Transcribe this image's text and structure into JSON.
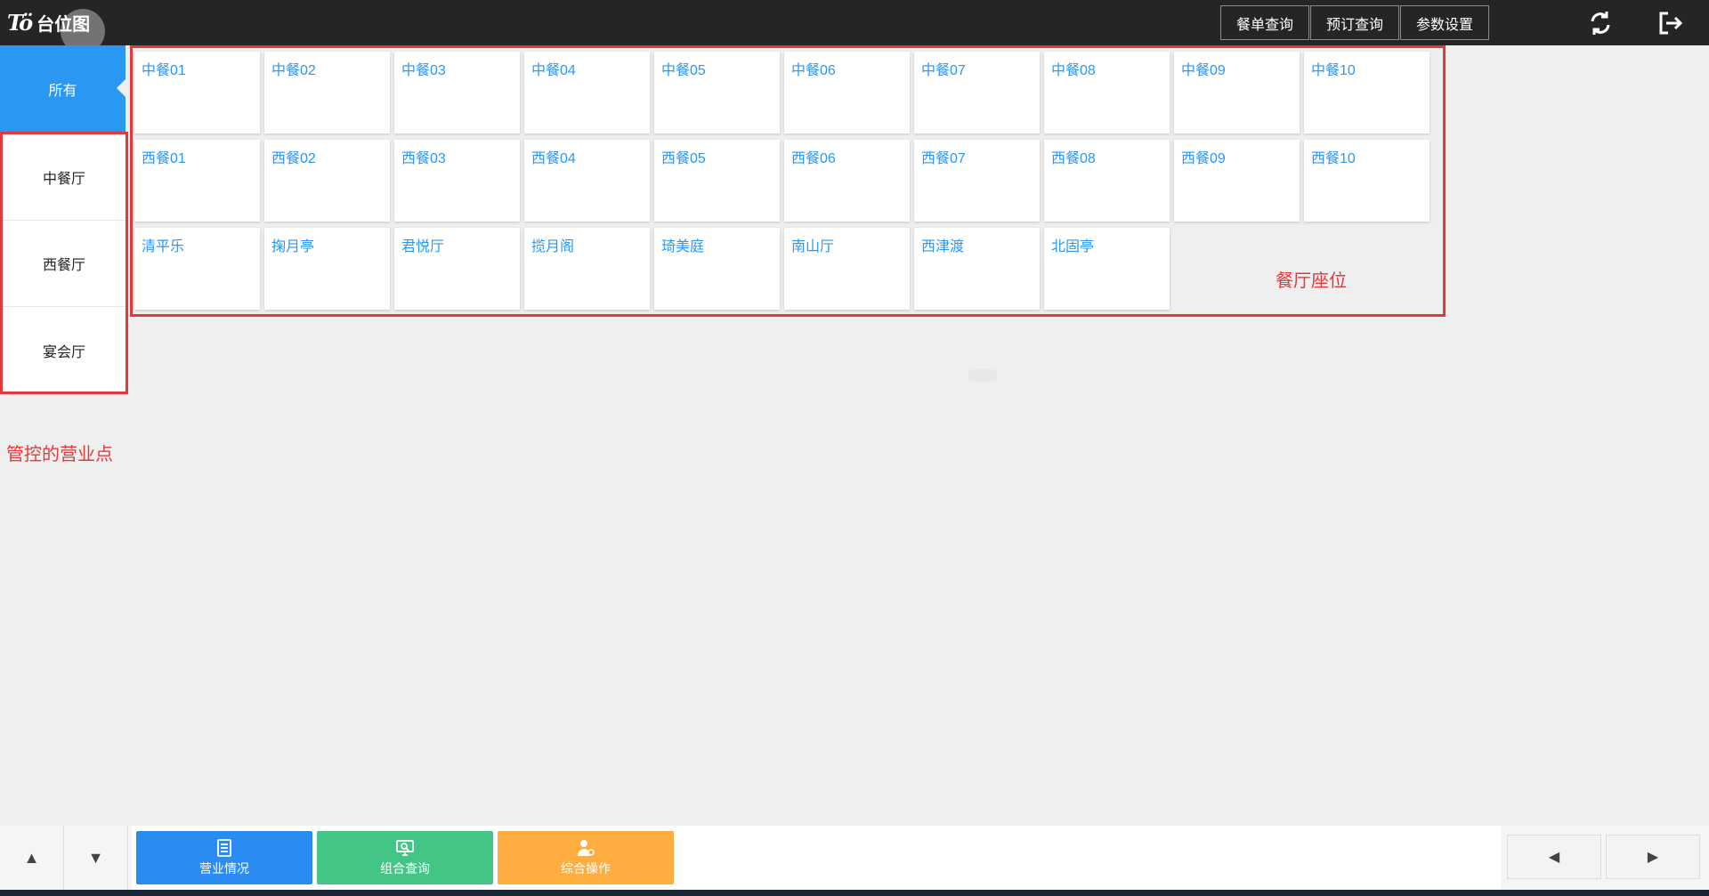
{
  "app": {
    "logo_mark": "Tö",
    "title": "台位图"
  },
  "header": {
    "menu": [
      "餐单查询",
      "预订查询",
      "参数设置"
    ],
    "refresh_icon": "refresh-icon",
    "logout_icon": "logout-icon"
  },
  "sidebar": {
    "all_label": "所有",
    "items": [
      "中餐厅",
      "西餐厅",
      "宴会厅"
    ],
    "annotation": "管控的营业点"
  },
  "tables": {
    "annotation": "餐厅座位",
    "rows": [
      [
        "中餐01",
        "中餐02",
        "中餐03",
        "中餐04",
        "中餐05",
        "中餐06",
        "中餐07",
        "中餐08",
        "中餐09",
        "中餐10"
      ],
      [
        "西餐01",
        "西餐02",
        "西餐03",
        "西餐04",
        "西餐05",
        "西餐06",
        "西餐07",
        "西餐08",
        "西餐09",
        "西餐10"
      ],
      [
        "清平乐",
        "掬月亭",
        "君悦厅",
        "揽月阁",
        "琦美庭",
        "南山厅",
        "西津渡",
        "北固亭"
      ]
    ]
  },
  "footer": {
    "actions": [
      {
        "label": "营业情况",
        "icon": "document-icon",
        "color": "#2a8cf0"
      },
      {
        "label": "组合查询",
        "icon": "monitor-search-icon",
        "color": "#42c585"
      },
      {
        "label": "综合操作",
        "icon": "user-settings-icon",
        "color": "#ffad3f"
      }
    ],
    "up_icon": "triangle-up-icon",
    "down_icon": "triangle-down-icon",
    "prev_icon": "triangle-left-icon",
    "next_icon": "triangle-right-icon"
  }
}
